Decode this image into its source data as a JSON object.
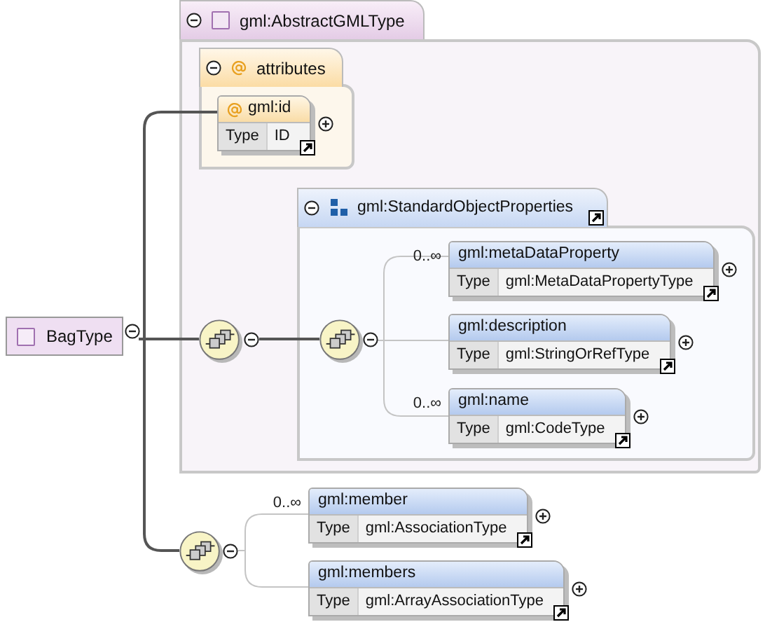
{
  "root": {
    "name": "BagType",
    "expanded": true
  },
  "base_type": {
    "name": "gml:AbstractGMLType",
    "expanded": true
  },
  "attributes": {
    "label": "attributes",
    "expanded": true,
    "items": [
      {
        "name": "gml:id",
        "type_label": "Type",
        "type": "ID",
        "expanded": false
      }
    ]
  },
  "compositors": [
    {
      "expanded": true
    },
    {
      "expanded": true
    },
    {
      "expanded": true
    }
  ],
  "group_ref": {
    "name": "gml:StandardObjectProperties",
    "expanded": true,
    "elements": [
      {
        "name": "gml:metaDataProperty",
        "type_label": "Type",
        "type": "gml:MetaDataPropertyType",
        "cardinality": "0..∞",
        "expanded": false
      },
      {
        "name": "gml:description",
        "type_label": "Type",
        "type": "gml:StringOrRefType",
        "expanded": false
      },
      {
        "name": "gml:name",
        "type_label": "Type",
        "type": "gml:CodeType",
        "cardinality": "0..∞",
        "expanded": false
      }
    ]
  },
  "elements": [
    {
      "name": "gml:member",
      "type_label": "Type",
      "type": "gml:AssociationType",
      "cardinality": "0..∞",
      "expanded": false
    },
    {
      "name": "gml:members",
      "type_label": "Type",
      "type": "gml:ArrayAssociationType",
      "expanded": false
    }
  ]
}
